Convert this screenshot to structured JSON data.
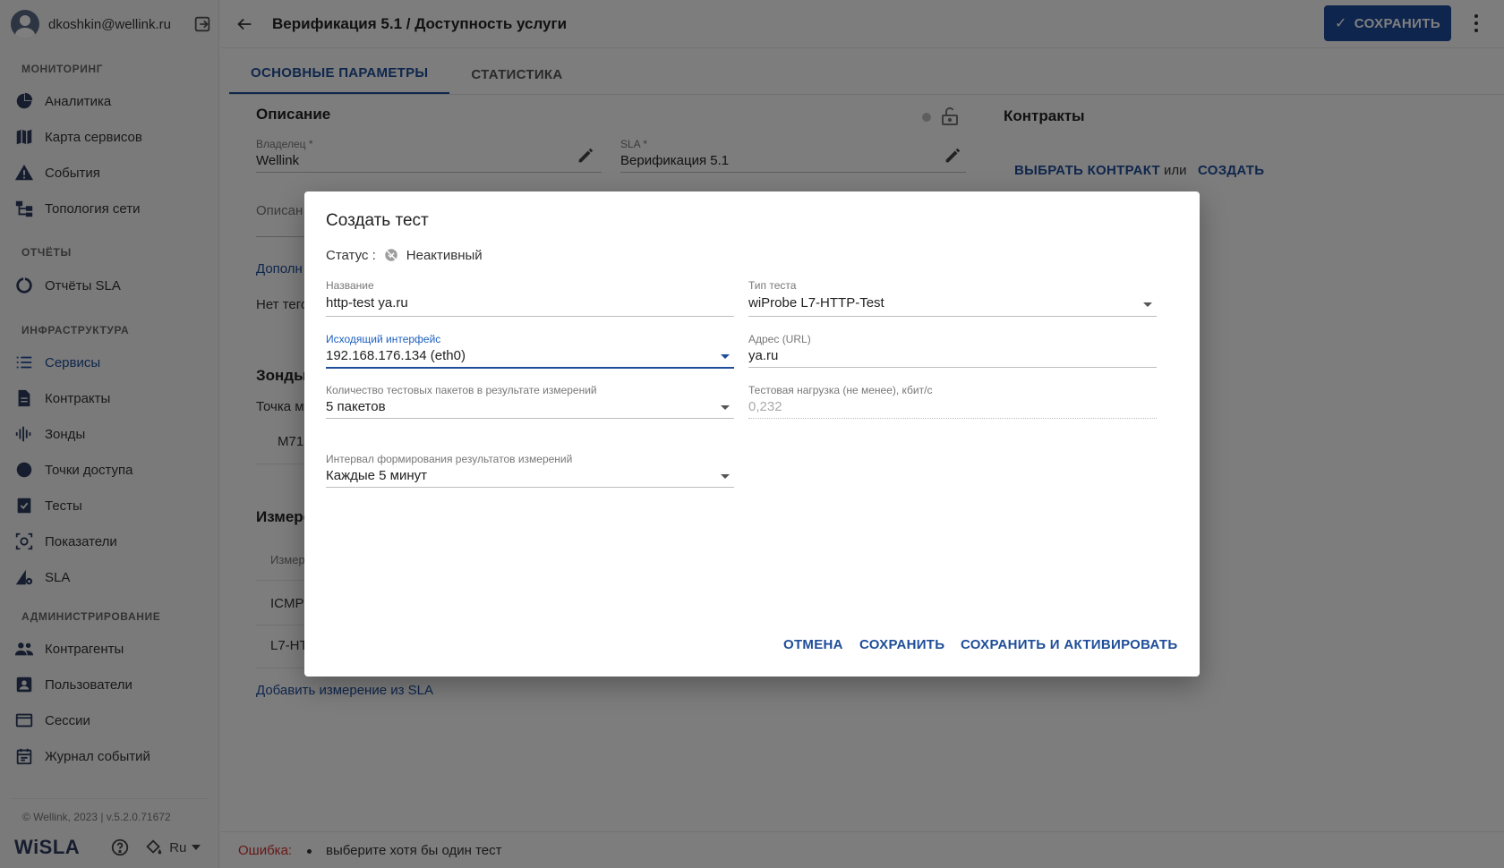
{
  "user": {
    "email": "dkoshkin@wellink.ru"
  },
  "sidebar": {
    "sections": [
      {
        "title": "МОНИТОРИНГ"
      },
      {
        "title": "ОТЧЁТЫ"
      },
      {
        "title": "ИНФРАСТРУКТУРА"
      },
      {
        "title": "АДМИНИСТРИРОВАНИЕ"
      }
    ],
    "items": [
      {
        "label": "Аналитика",
        "icon": "pie-chart-icon"
      },
      {
        "label": "Карта сервисов",
        "icon": "map-icon"
      },
      {
        "label": "События",
        "icon": "warning-icon"
      },
      {
        "label": "Топология сети",
        "icon": "topology-icon"
      },
      {
        "label": "Отчёты SLA",
        "icon": "report-circle-icon"
      },
      {
        "label": "Сервисы",
        "icon": "list-icon",
        "active": true
      },
      {
        "label": "Контракты",
        "icon": "document-icon"
      },
      {
        "label": "Зонды",
        "icon": "probe-icon"
      },
      {
        "label": "Точки доступа",
        "icon": "circle-icon"
      },
      {
        "label": "Тесты",
        "icon": "checklist-icon"
      },
      {
        "label": "Показатели",
        "icon": "metrics-icon"
      },
      {
        "label": "SLA",
        "icon": "sla-icon"
      },
      {
        "label": "Контрагенты",
        "icon": "people-icon"
      },
      {
        "label": "Пользователи",
        "icon": "user-card-icon"
      },
      {
        "label": "Сессии",
        "icon": "window-icon"
      },
      {
        "label": "Журнал событий",
        "icon": "calendar-icon"
      }
    ],
    "copyright": "© Wellink, 2023 | v.5.2.0.71672",
    "logo": "WiSLA",
    "language": "Ru"
  },
  "header": {
    "title": "Верификация 5.1 / Доступность услуги",
    "save_label": "СОХРАНИТЬ"
  },
  "tabs": [
    {
      "label": "ОСНОВНЫЕ ПАРАМЕТРЫ",
      "active": true
    },
    {
      "label": "СТАТИСТИКА",
      "active": false
    }
  ],
  "background": {
    "description_title": "Описание",
    "owner_label": "Владелец *",
    "owner_value": "Wellink",
    "sla_label": "SLA *",
    "sla_value": "Верификация 5.1",
    "description_partial": "Описан",
    "additional_partial": "Дополн",
    "tags_partial": "Нет тего",
    "probes_title_partial": "Зонды",
    "point_partial": "Точка м",
    "probe_value_partial": "M71",
    "measurements_title_partial": "Измере",
    "measure_header_partial": "Измер",
    "icmp_partial": "ICMP",
    "l7_partial": "L7-HT",
    "add_measurement": "Добавить измерение из SLA",
    "contracts_title": "Контракты",
    "choose_contract": "ВЫБРАТЬ КОНТРАКТ",
    "or": "или",
    "create": "СОЗДАТЬ"
  },
  "error": {
    "label": "Ошибка:",
    "message": "выберите хотя бы один тест"
  },
  "dialog": {
    "title": "Создать тест",
    "status_label": "Статус :",
    "status_value": "Неактивный",
    "fields": {
      "name": {
        "label": "Название",
        "value": "http-test ya.ru"
      },
      "test_type": {
        "label": "Тип теста",
        "value": "wiProbe L7-HTTP-Test"
      },
      "interface": {
        "label": "Исходящий интерфейс",
        "value": "192.168.176.134 (eth0)"
      },
      "url": {
        "label": "Адрес (URL)",
        "value": "ya.ru"
      },
      "packets": {
        "label": "Количество тестовых пакетов в результате измерений",
        "value": "5 пакетов"
      },
      "load": {
        "label": "Тестовая нагрузка (не менее), кбит/с",
        "value": "0,232"
      },
      "interval": {
        "label": "Интервал формирования результатов измерений",
        "value": "Каждые 5 минут"
      }
    },
    "buttons": {
      "cancel": "ОТМЕНА",
      "save": "СОХРАНИТЬ",
      "save_activate": "СОХРАНИТЬ И АКТИВИРОВАТЬ"
    }
  },
  "colors": {
    "accent": "#1e4d99",
    "error": "#d32f2f",
    "overlay": "rgba(0,0,0,0.5)"
  }
}
